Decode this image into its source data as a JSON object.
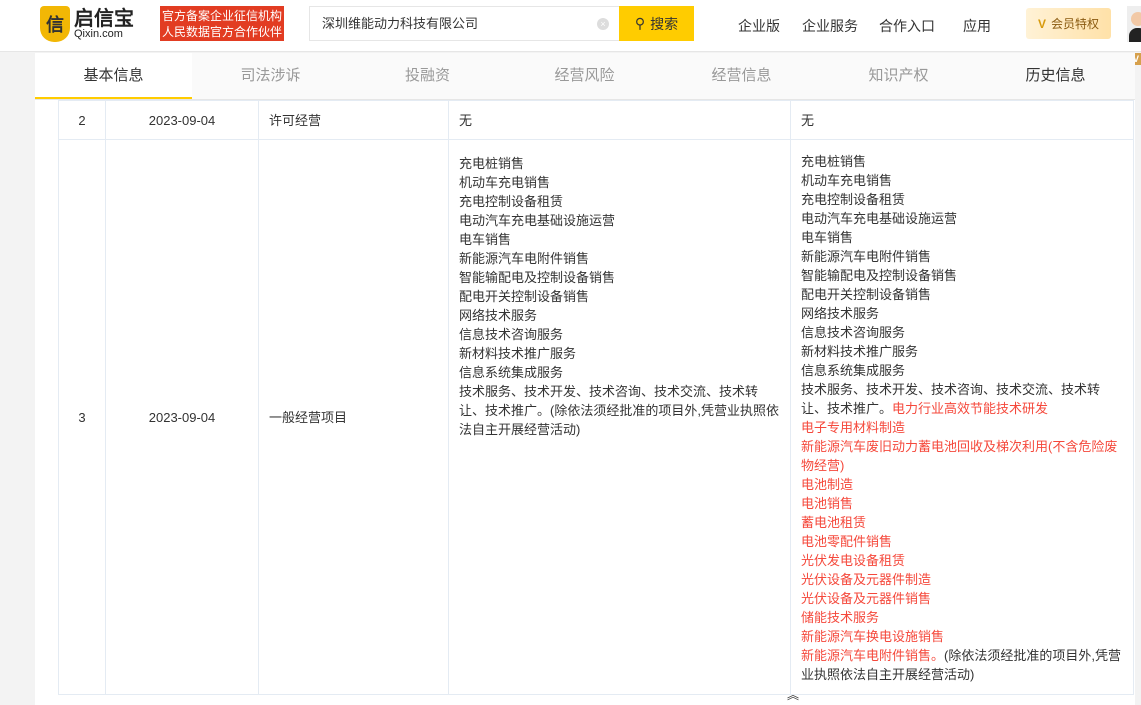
{
  "header": {
    "logo_cn": "启信宝",
    "logo_en": "Qixin.com",
    "badge_line1": "官方备案企业征信机构",
    "badge_line2": "人民数据官方合作伙伴",
    "search_value": "深圳维能动力科技有限公司",
    "search_button": "搜索",
    "nav": [
      "企业版",
      "企业服务",
      "合作入口",
      "应用"
    ],
    "vip_label": "会员特权",
    "vip_tag": "V"
  },
  "tabs": [
    "基本信息",
    "司法涉诉",
    "投融资",
    "经营风险",
    "经营信息",
    "知识产权",
    "历史信息"
  ],
  "rows": [
    {
      "index": "2",
      "date": "2023-09-04",
      "type": "许可经营",
      "before": "无",
      "after": "无"
    },
    {
      "index": "3",
      "date": "2023-09-04",
      "type": "一般经营项目"
    }
  ],
  "before_lines": [
    [
      {
        "t": "充电桩销售"
      }
    ],
    [
      {
        "t": "机动车充电销售"
      }
    ],
    [
      {
        "t": "充电控制设备租赁"
      }
    ],
    [
      {
        "t": "电动汽车充电基础设施运营"
      }
    ],
    [
      {
        "t": "电车销售"
      }
    ],
    [
      {
        "t": "新能源汽车电附件销售"
      }
    ],
    [
      {
        "t": "智能输配电及控制设备销售"
      }
    ],
    [
      {
        "t": "配电开关控制设备销售"
      }
    ],
    [
      {
        "t": "网络技术服务"
      }
    ],
    [
      {
        "t": "信息技术咨询服务"
      }
    ],
    [
      {
        "t": "新材料技术推广服务"
      }
    ],
    [
      {
        "t": "信息系统集成服务"
      }
    ],
    [
      {
        "t": "技术服务、技术开发、技术咨询、技术交流、技术转让、技术推广。(除依法须经批准的项目外,凭营业执照依法自主开展经营活动)"
      }
    ]
  ],
  "after_lines": [
    [
      {
        "t": "充电桩销售"
      }
    ],
    [
      {
        "t": "机动车充电销售"
      }
    ],
    [
      {
        "t": "充电控制设备租赁"
      }
    ],
    [
      {
        "t": "电动汽车充电基础设施运营"
      }
    ],
    [
      {
        "t": "电车销售"
      }
    ],
    [
      {
        "t": "新能源汽车电附件销售"
      }
    ],
    [
      {
        "t": "智能输配电及控制设备销售"
      }
    ],
    [
      {
        "t": "配电开关控制设备销售"
      }
    ],
    [
      {
        "t": "网络技术服务"
      }
    ],
    [
      {
        "t": "信息技术咨询服务"
      }
    ],
    [
      {
        "t": "新材料技术推广服务"
      }
    ],
    [
      {
        "t": "信息系统集成服务"
      }
    ],
    [
      {
        "t": "技术服务、技术开发、技术咨询、技术交流、技术转让、技术推广。"
      },
      {
        "t": "电力行业高效节能技术研发",
        "red": true
      }
    ],
    [
      {
        "t": "电子专用材料制造",
        "red": true
      }
    ],
    [
      {
        "t": "新能源汽车废旧动力蓄电池回收及梯次利用(不含危险废物经营)",
        "red": true
      }
    ],
    [
      {
        "t": "电池制造",
        "red": true
      }
    ],
    [
      {
        "t": "电池销售",
        "red": true
      }
    ],
    [
      {
        "t": "蓄电池租赁",
        "red": true
      }
    ],
    [
      {
        "t": "电池零配件销售",
        "red": true
      }
    ],
    [
      {
        "t": "光伏发电设备租赁",
        "red": true
      }
    ],
    [
      {
        "t": "光伏设备及元器件制造",
        "red": true
      }
    ],
    [
      {
        "t": "光伏设备及元器件销售",
        "red": true
      }
    ],
    [
      {
        "t": "储能技术服务",
        "red": true
      }
    ],
    [
      {
        "t": "新能源汽车换电设施销售",
        "red": true
      }
    ],
    [
      {
        "t": "新能源汽车电附件销售。",
        "red": true
      },
      {
        "t": "(除依法须经批准的项目外,凭营业执照依法自主开展经营活动)"
      }
    ]
  ],
  "colors": {
    "accent": "#ffcc00",
    "badge": "#e23c22",
    "highlight": "#f5483b"
  }
}
